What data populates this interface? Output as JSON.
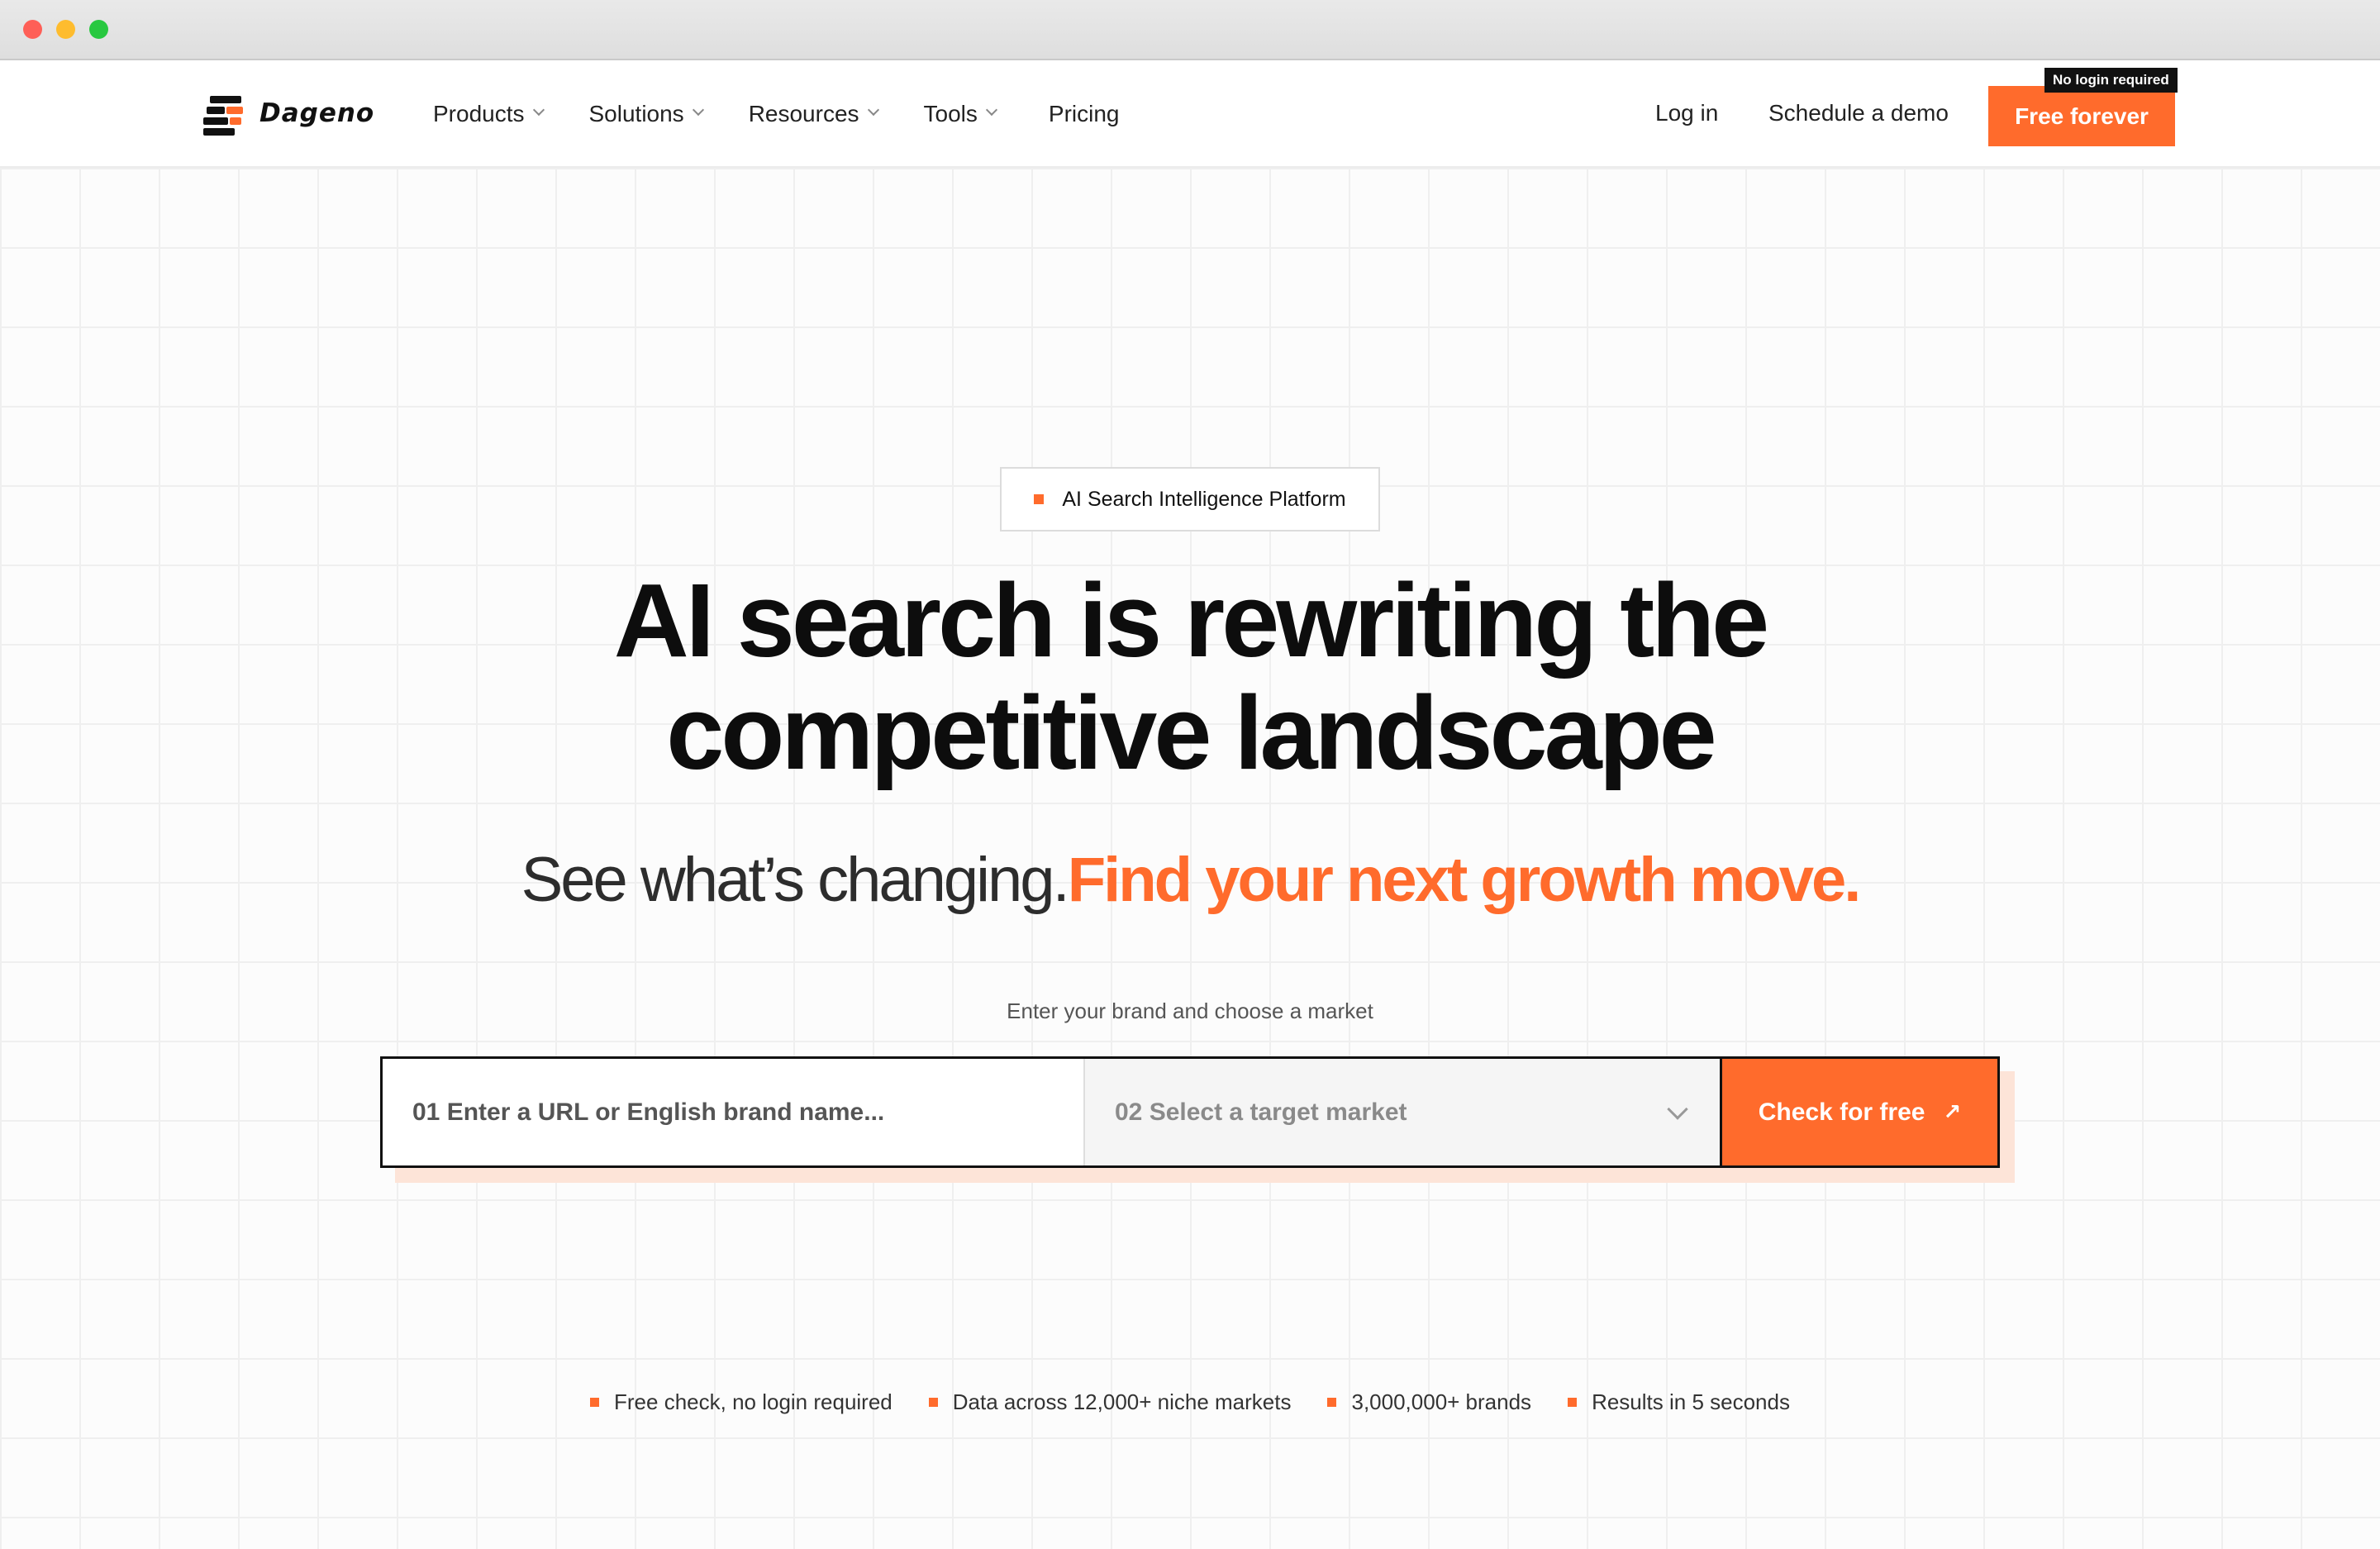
{
  "colors": {
    "accent": "#ff6b2c",
    "accent_tint": "#fde4d8",
    "ink": "#0d0d0d"
  },
  "brand": {
    "name": "Dageno"
  },
  "nav": {
    "menu": [
      {
        "label": "Products",
        "has_dropdown": true
      },
      {
        "label": "Solutions",
        "has_dropdown": true
      },
      {
        "label": "Resources",
        "has_dropdown": true
      },
      {
        "label": "Tools",
        "has_dropdown": true
      },
      {
        "label": "Pricing",
        "has_dropdown": false
      }
    ],
    "login_label": "Log in",
    "demo_label": "Schedule a demo",
    "cta_label": "Free forever",
    "cta_tag": "No login required"
  },
  "hero": {
    "badge": "AI Search Intelligence Platform",
    "headline_line1": "AI search is rewriting the",
    "headline_line2": "competitive landscape",
    "subhead_grey": "See what’s changing.",
    "subhead_orange": "Find your next growth move.",
    "helper": "Enter your brand and choose a market"
  },
  "search": {
    "url_placeholder": "01 Enter a URL or English brand name...",
    "url_value": "",
    "market_selected": "02 Select a target market",
    "submit_label": "Check for free",
    "submit_icon": "arrow-up-right-icon"
  },
  "features": [
    "Free check, no login required",
    "Data across 12,000+ niche markets",
    "3,000,000+ brands",
    "Results in 5 seconds"
  ]
}
